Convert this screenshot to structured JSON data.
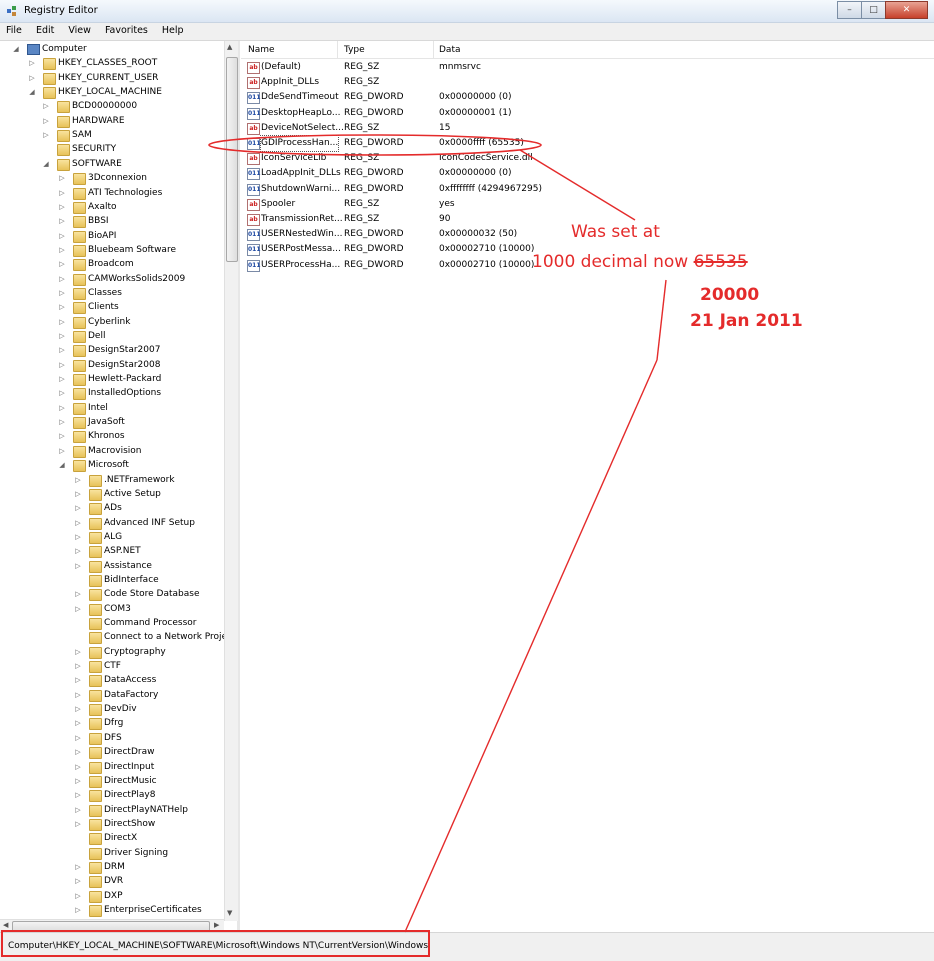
{
  "window": {
    "title": "Registry Editor",
    "buttons": {
      "minimize": "–",
      "maximize": "□",
      "close": "✕"
    }
  },
  "menu": [
    "File",
    "Edit",
    "View",
    "Favorites",
    "Help"
  ],
  "tree": [
    {
      "label": "Computer",
      "level": 0,
      "expander": "open",
      "icon": "computer-icon"
    },
    {
      "label": "HKEY_CLASSES_ROOT",
      "level": 1,
      "expander": "closed"
    },
    {
      "label": "HKEY_CURRENT_USER",
      "level": 1,
      "expander": "closed"
    },
    {
      "label": "HKEY_LOCAL_MACHINE",
      "level": 1,
      "expander": "open"
    },
    {
      "label": "BCD00000000",
      "level": 2,
      "expander": "closed"
    },
    {
      "label": "HARDWARE",
      "level": 2,
      "expander": "closed"
    },
    {
      "label": "SAM",
      "level": 2,
      "expander": "closed"
    },
    {
      "label": "SECURITY",
      "level": 2,
      "expander": "none"
    },
    {
      "label": "SOFTWARE",
      "level": 2,
      "expander": "open"
    },
    {
      "label": "3Dconnexion",
      "level": 3,
      "expander": "closed"
    },
    {
      "label": "ATI Technologies",
      "level": 3,
      "expander": "closed"
    },
    {
      "label": "Axalto",
      "level": 3,
      "expander": "closed"
    },
    {
      "label": "BBSI",
      "level": 3,
      "expander": "closed"
    },
    {
      "label": "BioAPI",
      "level": 3,
      "expander": "closed"
    },
    {
      "label": "Bluebeam Software",
      "level": 3,
      "expander": "closed"
    },
    {
      "label": "Broadcom",
      "level": 3,
      "expander": "closed"
    },
    {
      "label": "CAMWorksSolids2009",
      "level": 3,
      "expander": "closed"
    },
    {
      "label": "Classes",
      "level": 3,
      "expander": "closed"
    },
    {
      "label": "Clients",
      "level": 3,
      "expander": "closed"
    },
    {
      "label": "Cyberlink",
      "level": 3,
      "expander": "closed"
    },
    {
      "label": "Dell",
      "level": 3,
      "expander": "closed"
    },
    {
      "label": "DesignStar2007",
      "level": 3,
      "expander": "closed"
    },
    {
      "label": "DesignStar2008",
      "level": 3,
      "expander": "closed"
    },
    {
      "label": "Hewlett-Packard",
      "level": 3,
      "expander": "closed"
    },
    {
      "label": "InstalledOptions",
      "level": 3,
      "expander": "closed"
    },
    {
      "label": "Intel",
      "level": 3,
      "expander": "closed"
    },
    {
      "label": "JavaSoft",
      "level": 3,
      "expander": "closed"
    },
    {
      "label": "Khronos",
      "level": 3,
      "expander": "closed"
    },
    {
      "label": "Macrovision",
      "level": 3,
      "expander": "closed"
    },
    {
      "label": "Microsoft",
      "level": 3,
      "expander": "open"
    },
    {
      "label": ".NETFramework",
      "level": 4,
      "expander": "closed"
    },
    {
      "label": "Active Setup",
      "level": 4,
      "expander": "closed"
    },
    {
      "label": "ADs",
      "level": 4,
      "expander": "closed"
    },
    {
      "label": "Advanced INF Setup",
      "level": 4,
      "expander": "closed"
    },
    {
      "label": "ALG",
      "level": 4,
      "expander": "closed"
    },
    {
      "label": "ASP.NET",
      "level": 4,
      "expander": "closed"
    },
    {
      "label": "Assistance",
      "level": 4,
      "expander": "closed"
    },
    {
      "label": "BidInterface",
      "level": 4,
      "expander": "none"
    },
    {
      "label": "Code Store Database",
      "level": 4,
      "expander": "closed"
    },
    {
      "label": "COM3",
      "level": 4,
      "expander": "closed"
    },
    {
      "label": "Command Processor",
      "level": 4,
      "expander": "none"
    },
    {
      "label": "Connect to a Network Projec",
      "level": 4,
      "expander": "none"
    },
    {
      "label": "Cryptography",
      "level": 4,
      "expander": "closed"
    },
    {
      "label": "CTF",
      "level": 4,
      "expander": "closed"
    },
    {
      "label": "DataAccess",
      "level": 4,
      "expander": "closed"
    },
    {
      "label": "DataFactory",
      "level": 4,
      "expander": "closed"
    },
    {
      "label": "DevDiv",
      "level": 4,
      "expander": "closed"
    },
    {
      "label": "Dfrg",
      "level": 4,
      "expander": "closed"
    },
    {
      "label": "DFS",
      "level": 4,
      "expander": "closed"
    },
    {
      "label": "DirectDraw",
      "level": 4,
      "expander": "closed"
    },
    {
      "label": "DirectInput",
      "level": 4,
      "expander": "closed"
    },
    {
      "label": "DirectMusic",
      "level": 4,
      "expander": "closed"
    },
    {
      "label": "DirectPlay8",
      "level": 4,
      "expander": "closed"
    },
    {
      "label": "DirectPlayNATHelp",
      "level": 4,
      "expander": "closed"
    },
    {
      "label": "DirectShow",
      "level": 4,
      "expander": "closed"
    },
    {
      "label": "DirectX",
      "level": 4,
      "expander": "none"
    },
    {
      "label": "Driver Signing",
      "level": 4,
      "expander": "none"
    },
    {
      "label": "DRM",
      "level": 4,
      "expander": "closed"
    },
    {
      "label": "DVR",
      "level": 4,
      "expander": "closed"
    },
    {
      "label": "DXP",
      "level": 4,
      "expander": "closed"
    },
    {
      "label": "EnterpriseCertificates",
      "level": 4,
      "expander": "closed"
    }
  ],
  "list": {
    "columns": {
      "name": "Name",
      "type": "Type",
      "data": "Data"
    },
    "rows": [
      {
        "name": "(Default)",
        "type": "REG_SZ",
        "data": "mnmsrvc",
        "icon": "ab"
      },
      {
        "name": "AppInit_DLLs",
        "type": "REG_SZ",
        "data": "",
        "icon": "ab"
      },
      {
        "name": "DdeSendTimeout",
        "type": "REG_DWORD",
        "data": "0x00000000 (0)",
        "icon": "dw"
      },
      {
        "name": "DesktopHeapLo...",
        "type": "REG_DWORD",
        "data": "0x00000001 (1)",
        "icon": "dw"
      },
      {
        "name": "DeviceNotSelect...",
        "type": "REG_SZ",
        "data": "15",
        "icon": "ab"
      },
      {
        "name": "GDIProcessHan...",
        "type": "REG_DWORD",
        "data": "0x0000ffff (65535)",
        "icon": "dw",
        "focused": true
      },
      {
        "name": "IconServiceLib",
        "type": "REG_SZ",
        "data": "IconCodecService.dll",
        "icon": "ab"
      },
      {
        "name": "LoadAppInit_DLLs",
        "type": "REG_DWORD",
        "data": "0x00000000 (0)",
        "icon": "dw"
      },
      {
        "name": "ShutdownWarni...",
        "type": "REG_DWORD",
        "data": "0xffffffff (4294967295)",
        "icon": "dw"
      },
      {
        "name": "Spooler",
        "type": "REG_SZ",
        "data": "yes",
        "icon": "ab"
      },
      {
        "name": "TransmissionRet...",
        "type": "REG_SZ",
        "data": "90",
        "icon": "ab"
      },
      {
        "name": "USERNestedWin...",
        "type": "REG_DWORD",
        "data": "0x00000032 (50)",
        "icon": "dw"
      },
      {
        "name": "USERPostMessa...",
        "type": "REG_DWORD",
        "data": "0x00002710 (10000)",
        "icon": "dw"
      },
      {
        "name": "USERProcessHa...",
        "type": "REG_DWORD",
        "data": "0x00002710 (10000)",
        "icon": "dw"
      }
    ]
  },
  "status": "Computer\\HKEY_LOCAL_MACHINE\\SOFTWARE\\Microsoft\\Windows NT\\CurrentVersion\\Windows",
  "annotation": {
    "line1": "Was set at",
    "line2_prefix": "1000  decimal now ",
    "line2_struck": "65535",
    "line3": "20000",
    "line4": "21 Jan 2011",
    "color": "#e42b2b"
  }
}
